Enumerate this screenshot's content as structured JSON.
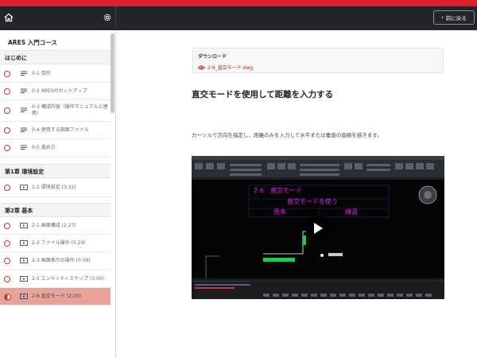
{
  "header": {
    "back_label": "前に戻る"
  },
  "sidebar": {
    "course_title": "ARES 入門コース",
    "sections": [
      {
        "title": "はじめに"
      },
      {
        "title": "第1章 環境設定"
      },
      {
        "title": "第2章 基本"
      }
    ],
    "items": [
      {
        "label": "0-1 目的",
        "type": "doc"
      },
      {
        "label": "0-2 ARESのセットアップ",
        "type": "doc"
      },
      {
        "label": "0-3 構成内容（操作マニュアルと連携）",
        "type": "doc"
      },
      {
        "label": "0-4 使用する図面ファイル",
        "type": "doc"
      },
      {
        "label": "0-5 進め方",
        "type": "doc"
      },
      {
        "label": "1-1 環境設定 (3:32)",
        "type": "video"
      },
      {
        "label": "2-1 画面構成 (2:27)",
        "type": "video"
      },
      {
        "label": "2-2 ファイル操作 (5:29)",
        "type": "video"
      },
      {
        "label": "2-3 画面表示の操作 (0:56)",
        "type": "video"
      },
      {
        "label": "2-5 エンティティスナップ (3:00)",
        "type": "video"
      },
      {
        "label": "2-6 直交モード (2:20)",
        "type": "video"
      }
    ]
  },
  "main": {
    "download_title": "ダウンロード",
    "download_file": "2-6_直交モード.dwg",
    "lesson_title": "直交モードを使用して距離を入力する",
    "lesson_desc": "カーソルで方向を指定し、距離のみを入力して水平または垂直の直線を描きます。",
    "video_overlay": {
      "line1": "2-6　直交モード",
      "line2": "直交モードを使う",
      "line3a": "見本",
      "line3b": "練習"
    }
  },
  "colors": {
    "accent": "#d9232d",
    "active_bg": "#e8a297",
    "header_bg": "#22252a",
    "link": "#b5291f"
  }
}
